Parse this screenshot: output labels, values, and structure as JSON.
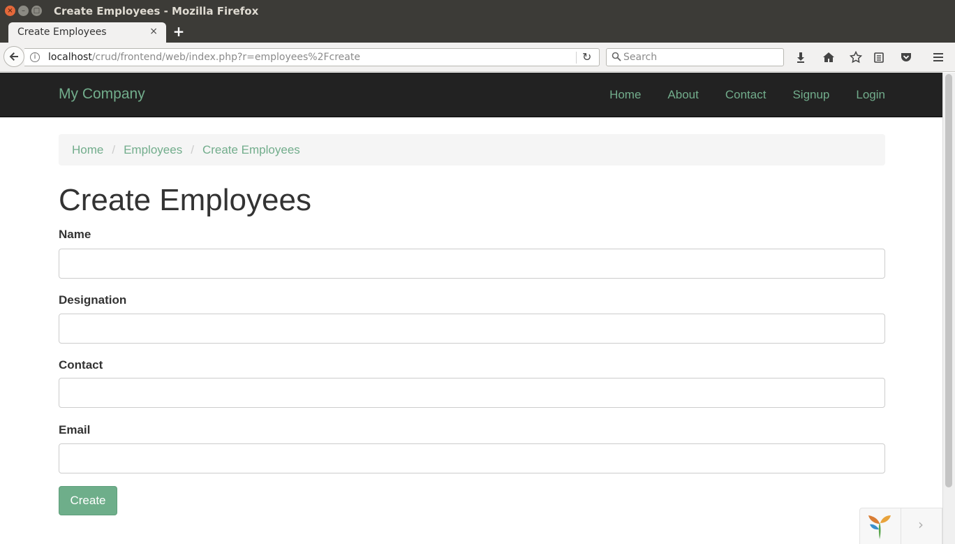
{
  "window": {
    "title": "Create Employees - Mozilla Firefox",
    "close_glyph": "×",
    "minimize_glyph": "–",
    "maximize_glyph": "□"
  },
  "tab": {
    "label": "Create Employees",
    "close_glyph": "×",
    "new_tab_glyph": "+"
  },
  "toolbar": {
    "url_host": "localhost",
    "url_path": "/crud/frontend/web/index.php?r=employees%2Fcreate",
    "reload_glyph": "↻",
    "search_placeholder": "Search",
    "icons": [
      "back-arrow-icon",
      "info-icon",
      "reload-icon",
      "search-icon",
      "download-icon",
      "home-icon",
      "bookmark-star-icon",
      "reading-list-icon",
      "pocket-icon",
      "menu-icon"
    ]
  },
  "site": {
    "brand": "My Company",
    "nav": [
      {
        "label": "Home"
      },
      {
        "label": "About"
      },
      {
        "label": "Contact"
      },
      {
        "label": "Signup"
      },
      {
        "label": "Login"
      }
    ],
    "accent_color": "#72ad8c",
    "navbar_color": "#222222"
  },
  "breadcrumb": {
    "items": [
      "Home",
      "Employees",
      "Create Employees"
    ],
    "separator": "/"
  },
  "page": {
    "title": "Create Employees"
  },
  "form": {
    "fields": [
      {
        "label": "Name",
        "value": ""
      },
      {
        "label": "Designation",
        "value": ""
      },
      {
        "label": "Contact",
        "value": ""
      },
      {
        "label": "Email",
        "value": ""
      }
    ],
    "submit_label": "Create",
    "button_color": "#6eae8a"
  },
  "debug_toolbar": {
    "logo": "yii-logo-icon",
    "toggle_glyph": "›"
  }
}
